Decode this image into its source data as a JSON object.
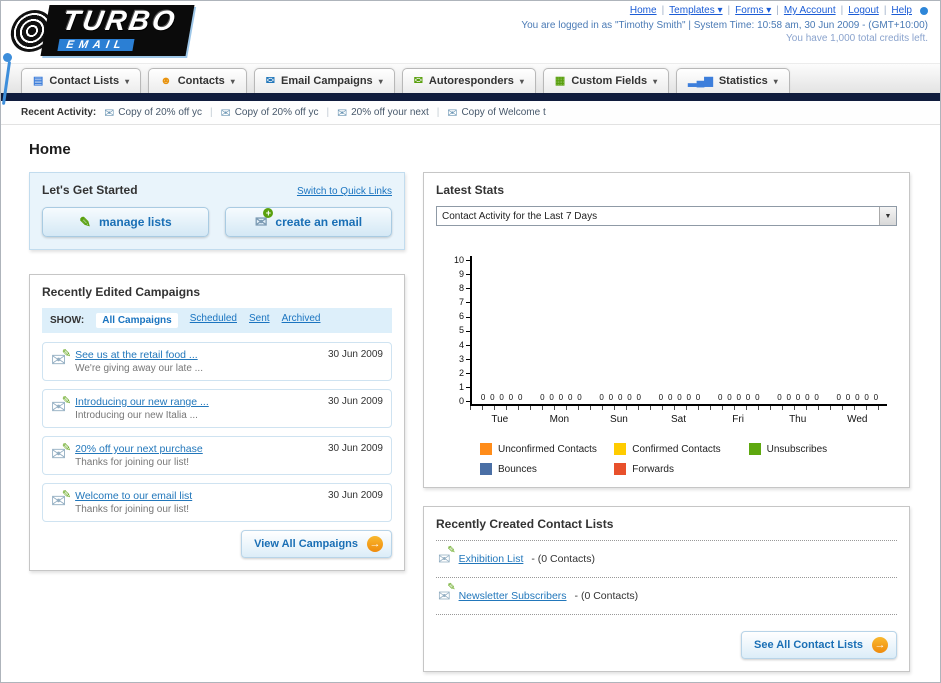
{
  "header": {
    "logo_main": "TURBO",
    "logo_sub": "EMAIL",
    "links": [
      {
        "label": "Home",
        "menu": false
      },
      {
        "label": "Templates",
        "menu": true
      },
      {
        "label": "Forms",
        "menu": true
      },
      {
        "label": "My Account",
        "menu": false
      },
      {
        "label": "Logout",
        "menu": false
      },
      {
        "label": "Help",
        "menu": false
      }
    ],
    "login_status": "You are logged in as \"Timothy Smith\" | System Time: 10:58 am, 30 Jun 2009 - (GMT+10:00)",
    "credits": "You have 1,000 total credits left."
  },
  "nav": {
    "tabs": [
      {
        "label": "Contact Lists",
        "icon": "contact-lists-icon"
      },
      {
        "label": "Contacts",
        "icon": "contacts-icon"
      },
      {
        "label": "Email Campaigns",
        "icon": "email-campaigns-icon"
      },
      {
        "label": "Autoresponders",
        "icon": "autoresponders-icon"
      },
      {
        "label": "Custom Fields",
        "icon": "custom-fields-icon"
      },
      {
        "label": "Statistics",
        "icon": "statistics-icon"
      }
    ]
  },
  "recent_activity": {
    "label": "Recent Activity:",
    "items": [
      "Copy of 20% off yc",
      "Copy of 20% off yc",
      "20% off your next",
      "Copy of Welcome t"
    ]
  },
  "page_title": "Home",
  "get_started": {
    "title": "Let's Get Started",
    "switch_link": "Switch to Quick Links",
    "buttons": [
      {
        "label": "manage lists",
        "icon": "pencil-icon"
      },
      {
        "label": "create an email",
        "icon": "envelope-plus-icon"
      }
    ]
  },
  "campaigns": {
    "title": "Recently Edited Campaigns",
    "show_label": "SHOW:",
    "filters": [
      "All Campaigns",
      "Scheduled",
      "Sent",
      "Archived"
    ],
    "selected_filter": "All Campaigns",
    "items": [
      {
        "title": "See us at the retail food ...",
        "subtitle": "We're giving away our late ...",
        "date": "30 Jun 2009"
      },
      {
        "title": "Introducing our new range ...",
        "subtitle": "Introducing our new Italia ...",
        "date": "30 Jun 2009"
      },
      {
        "title": "20% off your next purchase",
        "subtitle": "Thanks for joining our list!",
        "date": "30 Jun 2009"
      },
      {
        "title": "Welcome to our email list",
        "subtitle": "Thanks for joining our list!",
        "date": "30 Jun 2009"
      }
    ],
    "view_all": "View All Campaigns"
  },
  "stats": {
    "title": "Latest Stats",
    "dropdown_value": "Contact Activity for the Last 7 Days",
    "chart_data": {
      "type": "bar",
      "title": "Contact Activity for the Last 7 Days",
      "categories": [
        "Tue",
        "Mon",
        "Sun",
        "Sat",
        "Fri",
        "Thu",
        "Wed"
      ],
      "series": [
        {
          "name": "Unconfirmed Contacts",
          "color": "#FF8C1A",
          "values": [
            0,
            0,
            0,
            0,
            0,
            0,
            0
          ]
        },
        {
          "name": "Confirmed Contacts",
          "color": "#FFCC00",
          "values": [
            0,
            0,
            0,
            0,
            0,
            0,
            0
          ]
        },
        {
          "name": "Unsubscribes",
          "color": "#5EA80F",
          "values": [
            0,
            0,
            0,
            0,
            0,
            0,
            0
          ]
        },
        {
          "name": "Bounces",
          "color": "#4A6FA5",
          "values": [
            0,
            0,
            0,
            0,
            0,
            0,
            0
          ]
        },
        {
          "name": "Forwards",
          "color": "#E8502B",
          "values": [
            0,
            0,
            0,
            0,
            0,
            0,
            0
          ]
        }
      ],
      "ylim": [
        0,
        10
      ],
      "yticks": [
        0,
        1,
        2,
        3,
        4,
        5,
        6,
        7,
        8,
        9,
        10
      ],
      "grid": false,
      "legend_position": "bottom",
      "data_labels": true
    }
  },
  "contact_lists": {
    "title": "Recently Created Contact Lists",
    "items": [
      {
        "name": "Exhibition List",
        "suffix": "- (0 Contacts)"
      },
      {
        "name": "Newsletter Subscribers",
        "suffix": "- (0 Contacts)"
      }
    ],
    "see_all": "See All Contact Lists"
  }
}
